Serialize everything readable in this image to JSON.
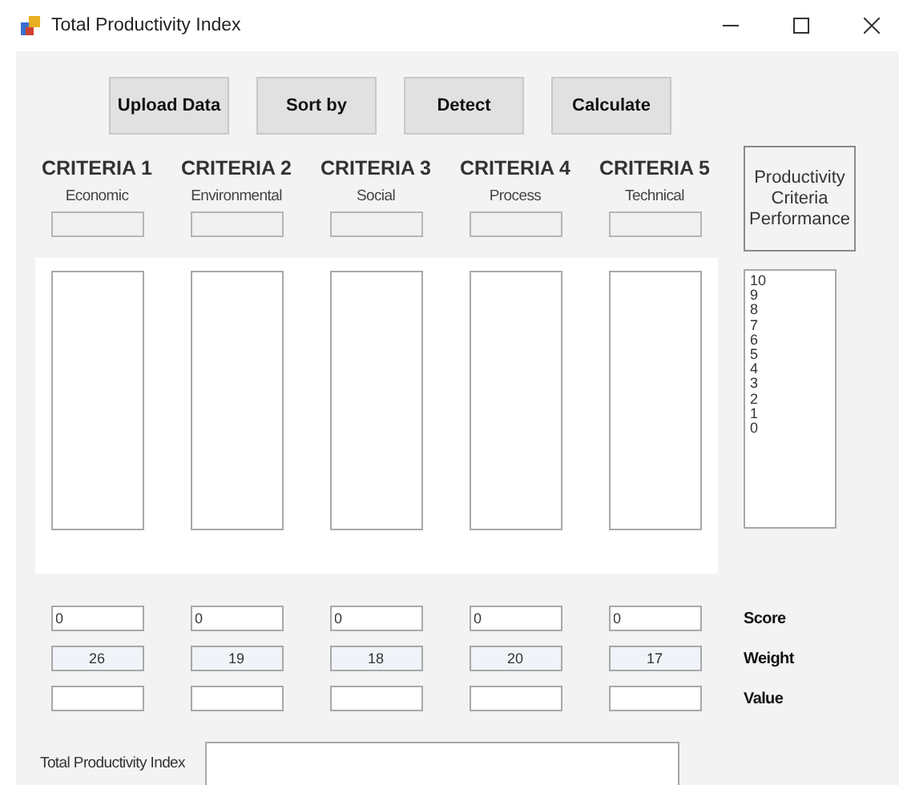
{
  "window": {
    "title": "Total Productivity Index"
  },
  "buttons": [
    "Upload Data",
    "Sort by",
    "Detect",
    "Calculate"
  ],
  "criteria": [
    {
      "title": "CRITERIA 1",
      "subtitle": "Economic",
      "score": "0",
      "weight": "26"
    },
    {
      "title": "CRITERIA 2",
      "subtitle": "Environmental",
      "score": "0",
      "weight": "19"
    },
    {
      "title": "CRITERIA 3",
      "subtitle": "Social",
      "score": "0",
      "weight": "18"
    },
    {
      "title": "CRITERIA 4",
      "subtitle": "Process",
      "score": "0",
      "weight": "20"
    },
    {
      "title": "CRITERIA 5",
      "subtitle": "Technical",
      "score": "0",
      "weight": "17"
    }
  ],
  "performance_label": "Productivity Criteria Performance",
  "performance_list": [
    "10",
    "9",
    "8",
    "7",
    "6",
    "5",
    "4",
    "3",
    "2",
    "1",
    "0"
  ],
  "row_labels": [
    "Score",
    "Weight",
    "Value"
  ],
  "total": {
    "label": "Total Productivity Index"
  }
}
